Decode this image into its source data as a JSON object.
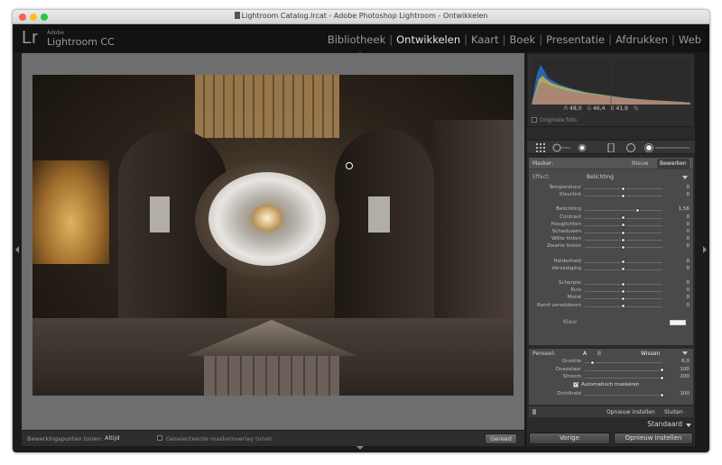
{
  "window": {
    "title": "Lightroom Catalog.lrcat - Adobe Photoshop Lightroom - Ontwikkelen"
  },
  "app": {
    "logo": "Lr",
    "brand_small": "Adobe",
    "brand_name": "Lightroom CC"
  },
  "modules": [
    {
      "label": "Bibliotheek",
      "active": false
    },
    {
      "label": "Ontwikkelen",
      "active": true
    },
    {
      "label": "Kaart",
      "active": false
    },
    {
      "label": "Boek",
      "active": false
    },
    {
      "label": "Presentatie",
      "active": false
    },
    {
      "label": "Afdrukken",
      "active": false
    },
    {
      "label": "Web",
      "active": false
    }
  ],
  "toolbar": {
    "pins_label": "Bewerkingspunten tonen:",
    "pins_value": "Altijd",
    "overlay_label": "Geselecteerde maskeroverlay tonen",
    "done_label": "Gereed"
  },
  "histogram": {
    "r_label": "R",
    "r_value": "48,0",
    "g_label": "G",
    "g_value": "46,4",
    "b_label": "B",
    "b_value": "41,9",
    "unit": "%",
    "original_label": "Originele foto"
  },
  "mask": {
    "label": "Masker:",
    "new_label": "Nieuw",
    "edit_label": "Bewerken",
    "effect_label": "Effect:",
    "effect_value": "Belichting",
    "color_label": "Kleur",
    "groups": [
      [
        {
          "name": "Temperatuur",
          "value": "0",
          "pos": 0.5
        },
        {
          "name": "Kleurtint",
          "value": "0",
          "pos": 0.5
        }
      ],
      [
        {
          "name": "Belichting",
          "value": "1,56",
          "pos": 0.69
        },
        {
          "name": "Contrast",
          "value": "0",
          "pos": 0.5
        },
        {
          "name": "Hooglichten",
          "value": "0",
          "pos": 0.5
        },
        {
          "name": "Schaduwen",
          "value": "0",
          "pos": 0.5
        },
        {
          "name": "Witte tinten",
          "value": "0",
          "pos": 0.5
        },
        {
          "name": "Zwarte tinten",
          "value": "0",
          "pos": 0.5
        }
      ],
      [
        {
          "name": "Helderheid",
          "value": "0",
          "pos": 0.5
        },
        {
          "name": "Verzadiging",
          "value": "0",
          "pos": 0.5
        }
      ],
      [
        {
          "name": "Scherpte",
          "value": "0",
          "pos": 0.5
        },
        {
          "name": "Ruis",
          "value": "0",
          "pos": 0.5
        },
        {
          "name": "Moiré",
          "value": "0",
          "pos": 0.5
        },
        {
          "name": "Rand verwijderen",
          "value": "0",
          "pos": 0.5
        }
      ]
    ]
  },
  "brush": {
    "label": "Penseel:",
    "a_label": "A",
    "b_label": "B",
    "erase_label": "Wissen",
    "rows": [
      {
        "name": "Grootte",
        "value": "6,0",
        "pos": 0.1
      },
      {
        "name": "Doezelaar",
        "value": "100",
        "pos": 1.0
      },
      {
        "name": "Stroom",
        "value": "100",
        "pos": 1.0
      }
    ],
    "auto_mask_label": "Automatisch maskeren",
    "density": {
      "name": "Dichtheid",
      "value": "100",
      "pos": 1.0
    }
  },
  "panel_footer": {
    "reset_label": "Opnieuw instellen",
    "close_label": "Sluiten"
  },
  "preset": {
    "label": "Standaard"
  },
  "bottom": {
    "prev_label": "Vorige",
    "reset_label": "Opnieuw instellen"
  },
  "colors": {
    "active_module": "#e6e6e6",
    "panel_bg": "#4a4a4a",
    "accent_swatch": "#f2f2f2"
  }
}
